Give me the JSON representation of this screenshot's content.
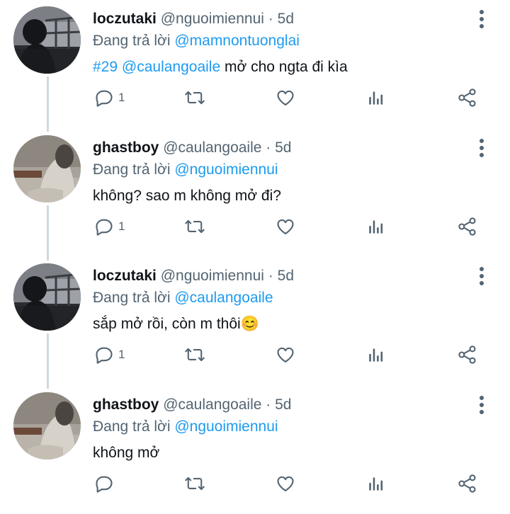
{
  "tweets": [
    {
      "name": "loczutaki",
      "handle": "@nguoimiennui",
      "separator": "·",
      "time": "5d",
      "reply_prefix": "Đang trả lời",
      "reply_to": "@mamnontuonglai",
      "text_parts": [
        {
          "text": "#29",
          "link": true
        },
        {
          "text": " ",
          "link": false
        },
        {
          "text": "@caulangoaile",
          "link": true
        },
        {
          "text": " mở cho ngta đi kìa",
          "link": false
        }
      ],
      "reply_count": "1",
      "avatar": "dark-figure-avatar"
    },
    {
      "name": "ghastboy",
      "handle": "@caulangoaile",
      "separator": "·",
      "time": "5d",
      "reply_prefix": "Đang trả lời",
      "reply_to": "@nguoimiennui",
      "text_parts": [
        {
          "text": "không? sao m không mở đi?",
          "link": false
        }
      ],
      "reply_count": "1",
      "avatar": "sleeping-person-avatar"
    },
    {
      "name": "loczutaki",
      "handle": "@nguoimiennui",
      "separator": "·",
      "time": "5d",
      "reply_prefix": "Đang trả lời",
      "reply_to": "@caulangoaile",
      "text_parts": [
        {
          "text": "sắp mở rồi, còn m thôi😊",
          "link": false
        }
      ],
      "reply_count": "1",
      "avatar": "dark-figure-avatar"
    },
    {
      "name": "ghastboy",
      "handle": "@caulangoaile",
      "separator": "·",
      "time": "5d",
      "reply_prefix": "Đang trả lời",
      "reply_to": "@nguoimiennui",
      "text_parts": [
        {
          "text": "không mở",
          "link": false
        }
      ],
      "reply_count": "",
      "avatar": "sleeping-person-avatar"
    }
  ],
  "icons": {
    "reply": "reply-icon",
    "retweet": "retweet-icon",
    "like": "heart-icon",
    "stats": "analytics-icon",
    "share": "share-icon",
    "more": "more-vertical-icon"
  },
  "colors": {
    "link": "#1d9bf0",
    "secondary_text": "#536471",
    "thread_line": "#cfd9de",
    "icon": "#536471"
  }
}
